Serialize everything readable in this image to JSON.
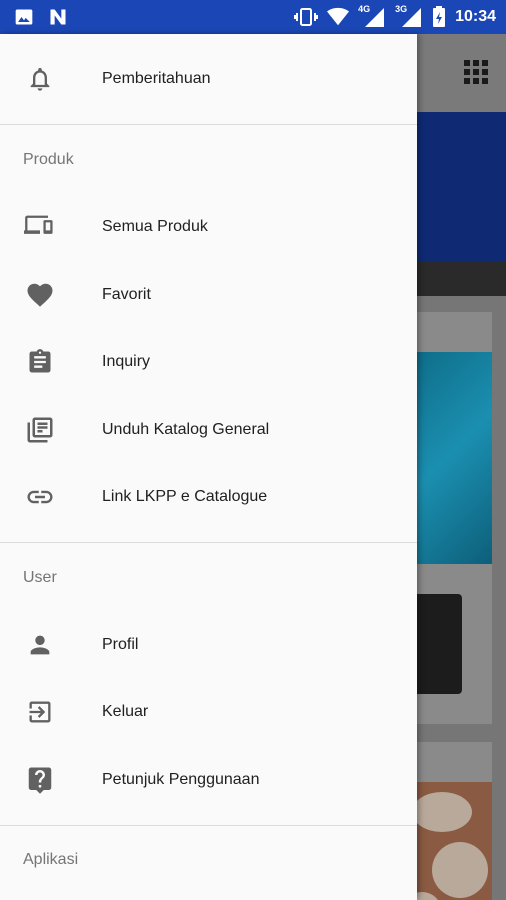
{
  "status_bar": {
    "time": "10:34",
    "network_4g": "4G",
    "network_3g": "3G",
    "left_icons": [
      "image-icon",
      "n-icon"
    ],
    "right_icons": [
      "vibrate-icon",
      "wifi-icon",
      "signal-4g-icon",
      "signal-3g-icon",
      "battery-icon"
    ]
  },
  "drawer": {
    "notifications": {
      "label": "Pemberitahuan",
      "icon": "bell-icon"
    },
    "sections": [
      {
        "title": "Produk",
        "items": [
          {
            "label": "Semua Produk",
            "icon": "devices-icon"
          },
          {
            "label": "Favorit",
            "icon": "heart-icon"
          },
          {
            "label": "Inquiry",
            "icon": "clipboard-icon"
          },
          {
            "label": "Unduh Katalog General",
            "icon": "library-books-icon"
          },
          {
            "label": "Link LKPP e Catalogue",
            "icon": "link-icon"
          }
        ]
      },
      {
        "title": "User",
        "items": [
          {
            "label": "Profil",
            "icon": "person-icon"
          },
          {
            "label": "Keluar",
            "icon": "exit-icon"
          },
          {
            "label": "Petunjuk Penggunaan",
            "icon": "help-icon"
          }
        ]
      },
      {
        "title": "Aplikasi",
        "items": []
      }
    ]
  },
  "colors": {
    "status_bar": "#1b47b6",
    "drawer_bg": "#fafafa",
    "icon": "#616161",
    "label": "#212121",
    "section_title": "#757575"
  }
}
